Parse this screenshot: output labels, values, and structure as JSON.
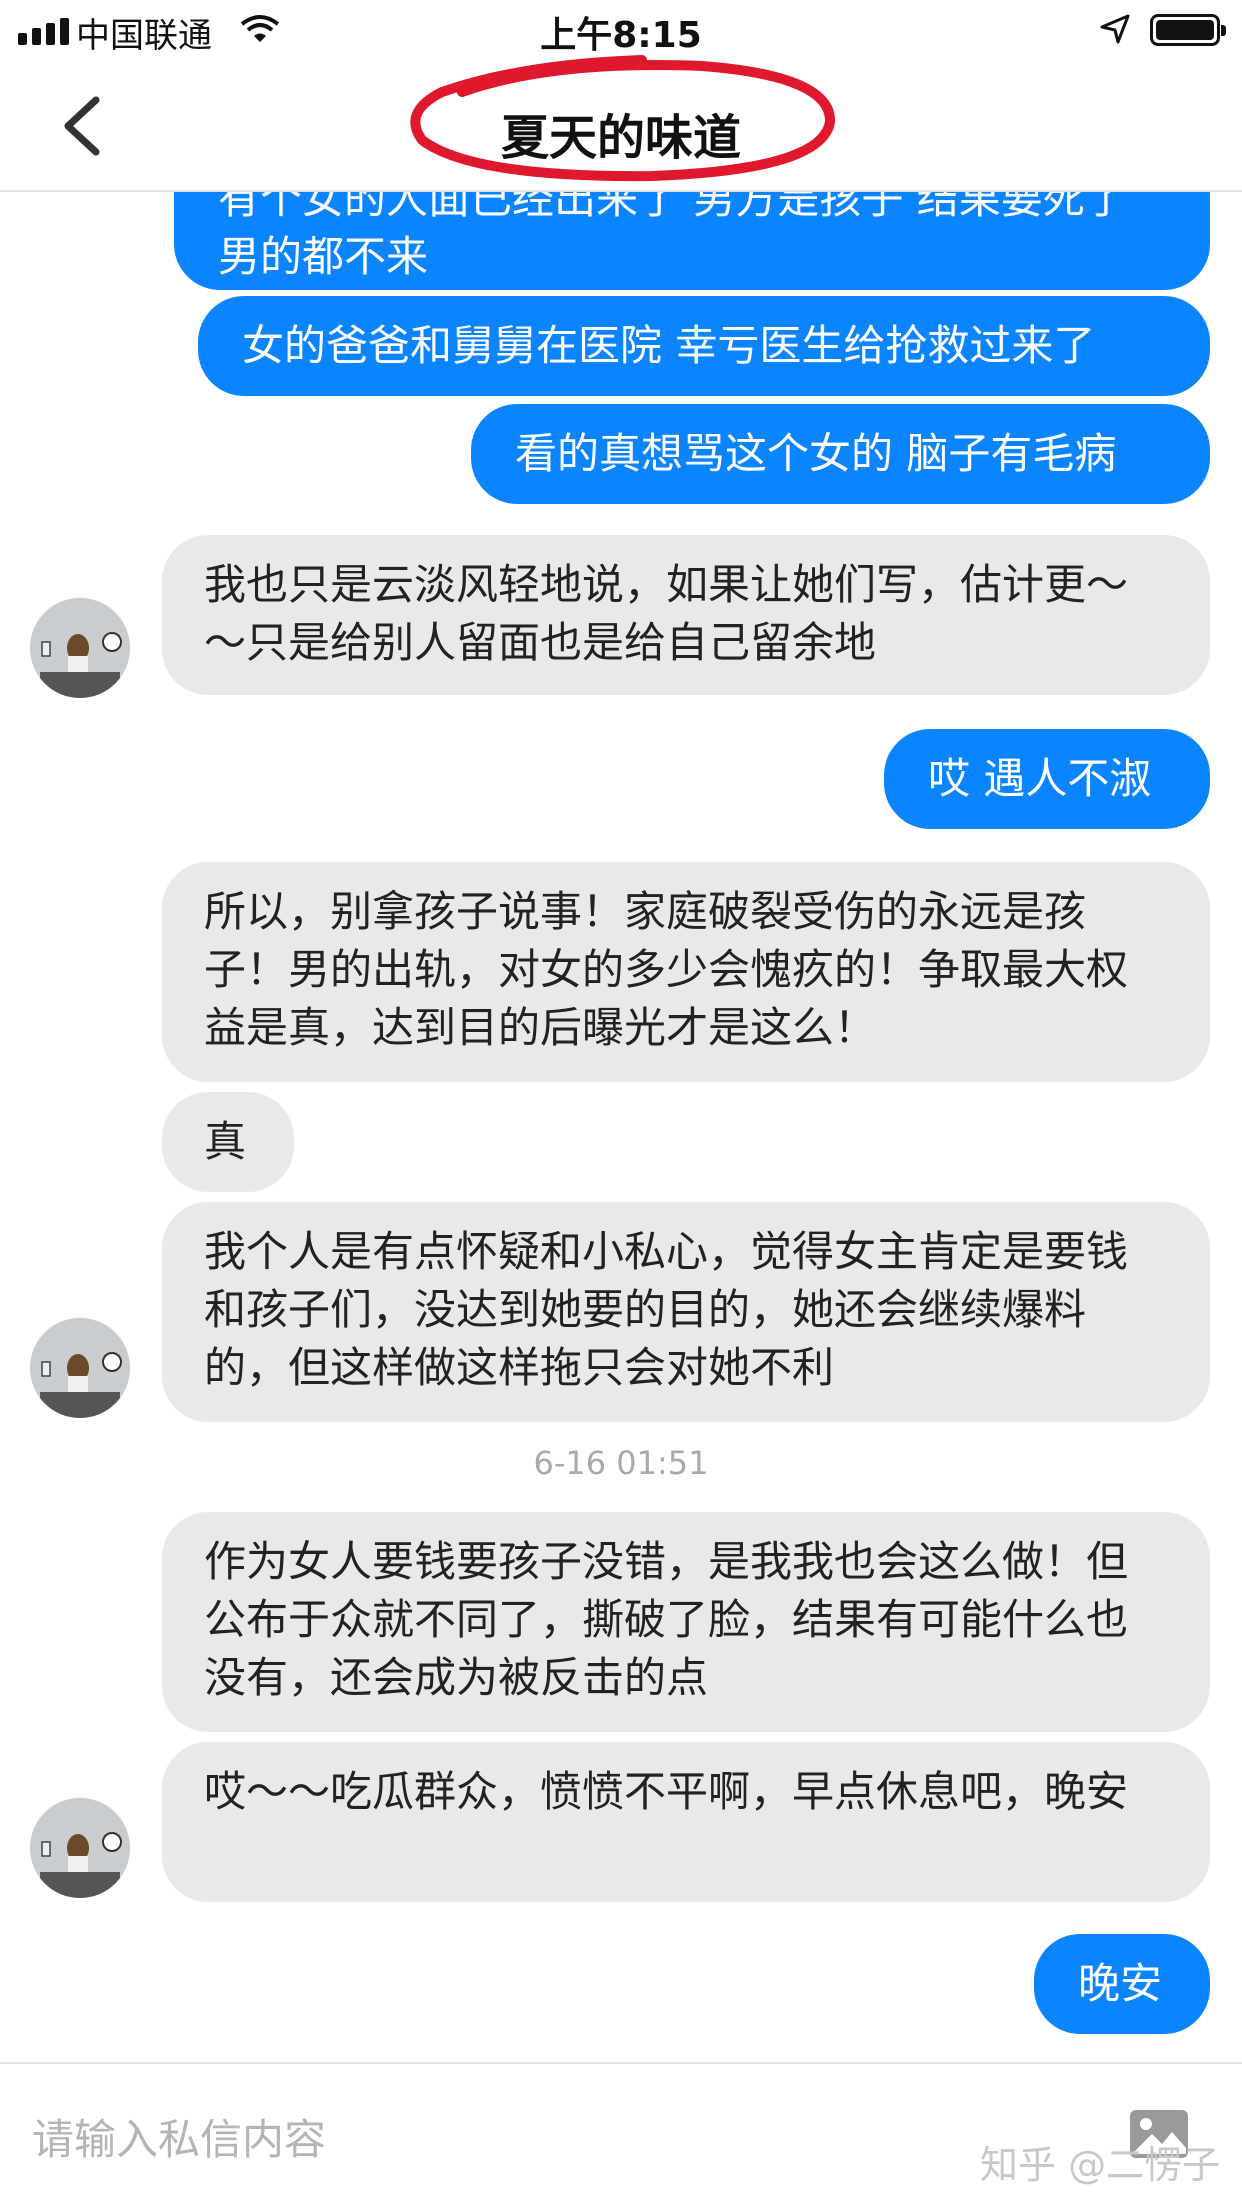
{
  "status_bar": {
    "carrier": "中国联通",
    "time": "上午8:15",
    "icons": [
      "signal-icon",
      "wifi-icon",
      "location-arrow-icon",
      "battery-icon"
    ]
  },
  "nav": {
    "back_icon": "chevron-left-icon",
    "title": "夏天的味道",
    "annotation_color": "#e0182d"
  },
  "messages": [
    {
      "side": "me",
      "text": "有个女的人面已经出来了 男方是孩子 结果要死了男的都不来"
    },
    {
      "side": "me",
      "text": "女的爸爸和舅舅在医院 幸亏医生给抢救过来了"
    },
    {
      "side": "me",
      "text": "看的真想骂这个女的 脑子有毛病"
    },
    {
      "side": "them",
      "text": "我也只是云淡风轻地说，如果让她们写，估计更～～只是给别人留面也是给自己留余地"
    },
    {
      "side": "me",
      "text": "哎 遇人不淑"
    },
    {
      "side": "them",
      "text": "所以，别拿孩子说事！家庭破裂受伤的永远是孩子！男的出轨，对女的多少会愧疚的！争取最大权益是真，达到目的后曝光才是这么！"
    },
    {
      "side": "them",
      "text": "真"
    },
    {
      "side": "them",
      "text": "我个人是有点怀疑和小私心，觉得女主肯定是要钱和孩子们，没达到她要的目的，她还会继续爆料的，但这样做这样拖只会对她不利"
    },
    {
      "side": "timestamp",
      "text": "6-16 01:51"
    },
    {
      "side": "them",
      "text": "作为女人要钱要孩子没错，是我我也会这么做！但公布于众就不同了，撕破了脸，结果有可能什么也没有，还会成为被反击的点"
    },
    {
      "side": "them",
      "text": "哎～～吃瓜群众，愤愤不平啊，早点休息吧，晚安"
    },
    {
      "side": "me",
      "text": "晚安"
    }
  ],
  "input": {
    "placeholder": "请输入私信内容",
    "image_button_icon": "image-icon"
  },
  "watermark": "知乎 @二愣子",
  "colors": {
    "sent_bubble": "#0a84ff",
    "received_bubble": "#e9e9e9",
    "timestamp": "#aaaaaa"
  }
}
